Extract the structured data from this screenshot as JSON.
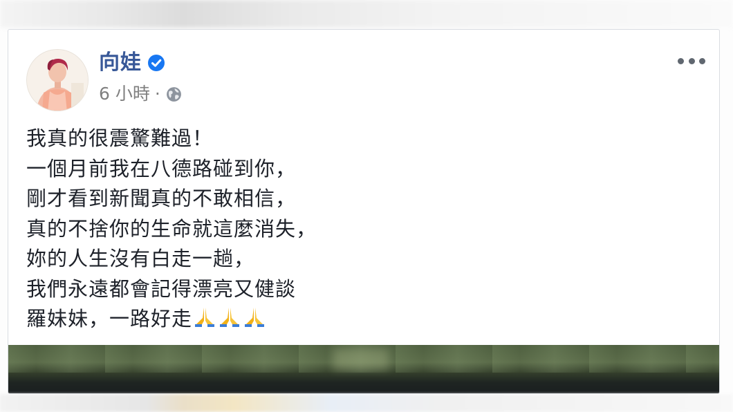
{
  "post": {
    "author": "向娃",
    "verified": true,
    "time": "6 小時",
    "separator": "·",
    "audience_icon": "globe-icon",
    "more_icon": "more-options-icon",
    "lines": [
      "我真的很震驚難過！",
      "一個月前我在八德路碰到你，",
      "剛才看到新聞真的不敢相信，",
      "真的不捨你的生命就這麼消失，",
      "妳的人生沒有白走一趟，",
      "我們永遠都會記得漂亮又健談",
      "羅妹妹，一路好走"
    ],
    "emoji": "praying-hands-icon"
  },
  "colors": {
    "author": "#385898",
    "verified": "#1877f2",
    "meta": "#7f7f7f",
    "text": "#1d2129",
    "emoji": "#f2b118"
  }
}
